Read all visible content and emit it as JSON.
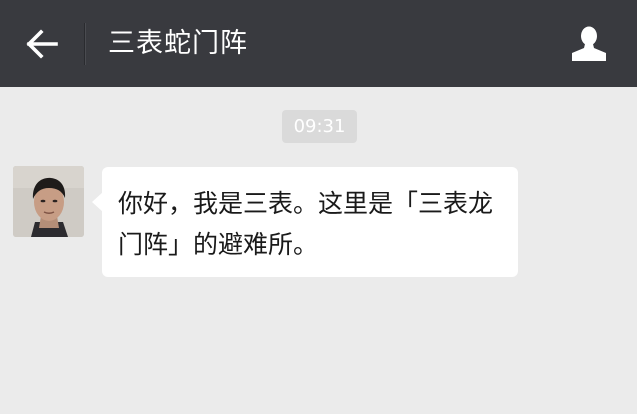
{
  "header": {
    "title": "三表蛇门阵",
    "back_icon": "arrow-left-icon",
    "profile_icon": "person-icon",
    "background_color": "#393a3f"
  },
  "chat": {
    "background_color": "#ebebeb",
    "timestamp": "09:31",
    "messages": [
      {
        "sender_avatar": "avatar-photo",
        "text": "你好，我是三表。这里是「三表龙门阵」的避难所。"
      }
    ]
  }
}
